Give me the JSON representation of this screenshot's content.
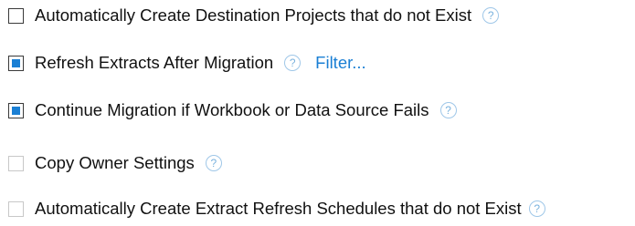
{
  "options": [
    {
      "label": "Automatically Create Destination Projects that do not Exist",
      "checked": false,
      "enabled": true,
      "help_icon": "?"
    },
    {
      "label": "Refresh Extracts After Migration",
      "checked": true,
      "enabled": true,
      "help_icon": "?",
      "link": "Filter..."
    },
    {
      "label": "Continue Migration if Workbook or Data Source Fails",
      "checked": true,
      "enabled": true,
      "help_icon": "?"
    },
    {
      "label": "Copy Owner Settings",
      "checked": false,
      "enabled": false,
      "help_icon": "?"
    },
    {
      "label": "Automatically Create Extract Refresh Schedules that do not Exist",
      "checked": false,
      "enabled": false,
      "help_icon": "?"
    }
  ],
  "colors": {
    "accent": "#1a7fd4",
    "help_icon": "#7ab2de",
    "checkbox_border": "#3a3a3a",
    "checkbox_border_disabled": "#c8c8c8"
  },
  "icons": {
    "help": "question-circle-icon",
    "checkbox_checked": "checkbox-checked-icon",
    "checkbox_unchecked": "checkbox-unchecked-icon"
  }
}
